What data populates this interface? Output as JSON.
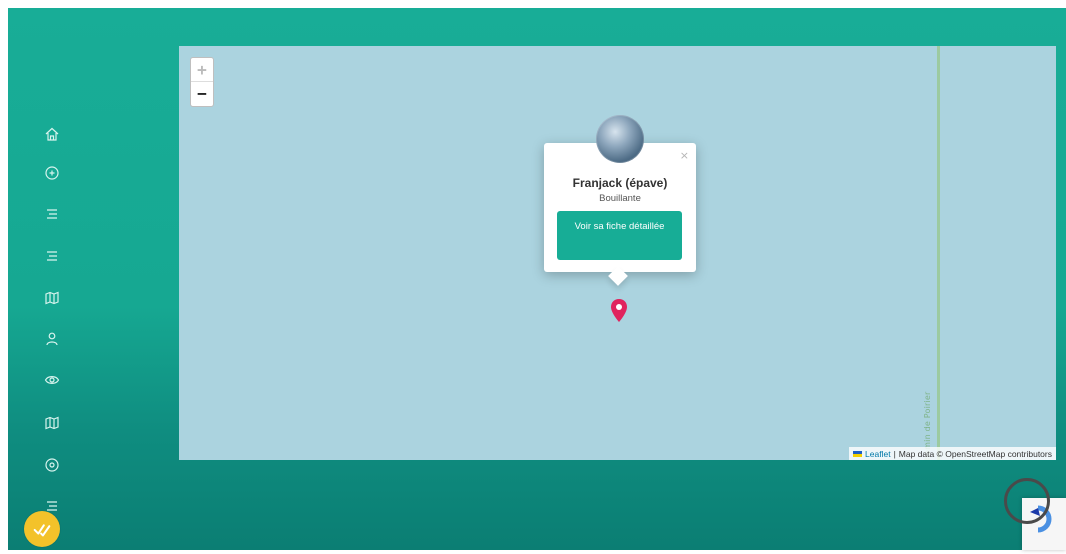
{
  "sidebar": {
    "icons": [
      {
        "name": "home-icon"
      },
      {
        "name": "plus-circle-icon"
      },
      {
        "name": "list-icon"
      },
      {
        "name": "list-icon"
      },
      {
        "name": "map-icon"
      },
      {
        "name": "user-icon"
      },
      {
        "name": "eye-icon"
      },
      {
        "name": "map-icon"
      },
      {
        "name": "location-icon"
      },
      {
        "name": "list-icon"
      }
    ],
    "logo": "checkmark-logo-icon"
  },
  "map": {
    "zoom_in": "+",
    "zoom_out": "−",
    "road_label": "Chemin de Poirier",
    "attribution": {
      "leaflet": "Leaflet",
      "separator": "|",
      "text": "Map data © OpenStreetMap contributors"
    }
  },
  "popup": {
    "close": "×",
    "title": "Franjack (épave)",
    "subtitle": "Bouillante",
    "button": "Voir sa fiche détaillée"
  },
  "colors": {
    "primary": "#17ad96",
    "map_water": "#abd3df",
    "marker": "#e0245e",
    "logo": "#f3c22a"
  }
}
